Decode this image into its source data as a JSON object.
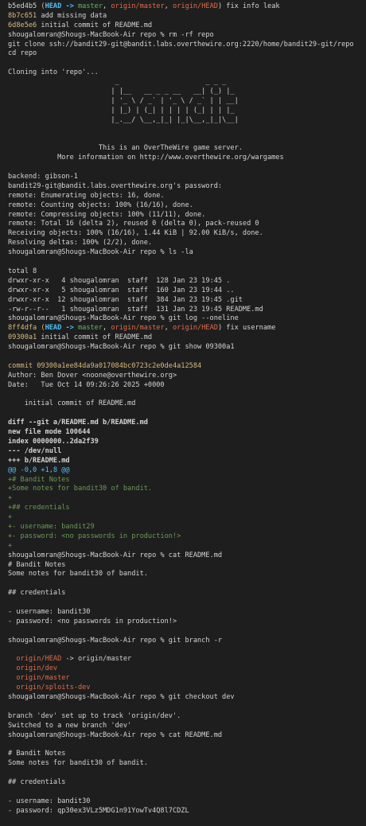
{
  "lines": [
    [
      [
        "b5ed4b5",
        ""
      ],
      [
        " (",
        "yellow"
      ],
      [
        "HEAD -> ",
        "cyan b"
      ],
      [
        "master",
        "grn"
      ],
      [
        ", ",
        ""
      ],
      [
        "origin/master",
        "red"
      ],
      [
        ", ",
        ""
      ],
      [
        "origin/HEAD",
        "red"
      ],
      [
        ") fix info leak",
        ""
      ]
    ],
    [
      [
        "8b7c651",
        "yellow"
      ],
      [
        " add missing data",
        ""
      ]
    ],
    [
      [
        "6d8e5e6",
        "yellow"
      ],
      [
        " initial commit of README.md",
        ""
      ]
    ],
    [
      [
        "shougalomran@Shougs-MacBook-Air repo % rm -rf repo",
        ""
      ]
    ],
    [
      [
        "git clone ssh://bandit29-git@bandit.labs.overthewire.org:2220/home/bandit29-git/repo",
        ""
      ]
    ],
    [
      [
        "cd repo",
        ""
      ]
    ],
    [
      [
        "",
        ""
      ]
    ],
    [
      [
        "Cloning into 'repo'...",
        ""
      ]
    ],
    [
      [
        "                          _                     _ _ _",
        ""
      ]
    ],
    [
      [
        "                         | |__   __ _ _ __   __| (_) |_",
        ""
      ]
    ],
    [
      [
        "                         | '_ \\ / _` | '_ \\ / _` | | __|",
        ""
      ]
    ],
    [
      [
        "                         | |_) | (_| | | | | (_| | | |_",
        ""
      ]
    ],
    [
      [
        "                         |_.__/ \\__,_|_| |_|\\__,_|_|\\__|",
        ""
      ]
    ],
    [
      [
        "",
        ""
      ]
    ],
    [
      [
        "",
        ""
      ]
    ],
    [
      [
        "                      This is an OverTheWire game server.",
        ""
      ]
    ],
    [
      [
        "            More information on http://www.overthewire.org/wargames",
        ""
      ]
    ],
    [
      [
        "",
        ""
      ]
    ],
    [
      [
        "backend: gibson-1",
        ""
      ]
    ],
    [
      [
        "bandit29-git@bandit.labs.overthewire.org's password:",
        ""
      ]
    ],
    [
      [
        "remote: Enumerating objects: 16, done.",
        ""
      ]
    ],
    [
      [
        "remote: Counting objects: 100% (16/16), done.",
        ""
      ]
    ],
    [
      [
        "remote: Compressing objects: 100% (11/11), done.",
        ""
      ]
    ],
    [
      [
        "remote: Total 16 (delta 2), reused 0 (delta 0), pack-reused 0",
        ""
      ]
    ],
    [
      [
        "Receiving objects: 100% (16/16), 1.44 KiB | 92.00 KiB/s, done.",
        ""
      ]
    ],
    [
      [
        "Resolving deltas: 100% (2/2), done.",
        ""
      ]
    ],
    [
      [
        "shougalomran@Shougs-MacBook-Air repo % ls -la",
        ""
      ]
    ],
    [
      [
        "",
        ""
      ]
    ],
    [
      [
        "total 8",
        ""
      ]
    ],
    [
      [
        "drwxr-xr-x   4 shougalomran  staff  128 Jan 23 19:45 .",
        ""
      ]
    ],
    [
      [
        "drwxr-xr-x   5 shougalomran  staff  160 Jan 23 19:44 ..",
        ""
      ]
    ],
    [
      [
        "drwxr-xr-x  12 shougalomran  staff  384 Jan 23 19:45 .git",
        ""
      ]
    ],
    [
      [
        "-rw-r--r--   1 shougalomran  staff  131 Jan 23 19:45 README.md",
        ""
      ]
    ],
    [
      [
        "shougalomran@Shougs-MacBook-Air repo % git log --oneline",
        ""
      ]
    ],
    [
      [
        "8ff4dfa",
        "yellow"
      ],
      [
        " (",
        "yellow"
      ],
      [
        "HEAD -> ",
        "cyan b"
      ],
      [
        "master",
        "grn"
      ],
      [
        ", ",
        ""
      ],
      [
        "origin/master",
        "red"
      ],
      [
        ", ",
        ""
      ],
      [
        "origin/HEAD",
        "red"
      ],
      [
        ") fix username",
        ""
      ]
    ],
    [
      [
        "09300a1",
        "yellow"
      ],
      [
        " initial commit of README.md",
        ""
      ]
    ],
    [
      [
        "shougalomran@Shougs-MacBook-Air repo % git show 09300a1",
        ""
      ]
    ],
    [
      [
        "",
        ""
      ]
    ],
    [
      [
        "commit 09300a1ee84da9a017084bc0723c2e0de4a12584",
        "yellow"
      ]
    ],
    [
      [
        "Author: Ben Dover <noone@overthewire.org>",
        ""
      ]
    ],
    [
      [
        "Date:   Tue Oct 14 09:26:26 2025 +0000",
        ""
      ]
    ],
    [
      [
        "",
        ""
      ]
    ],
    [
      [
        "    initial commit of README.md",
        ""
      ]
    ],
    [
      [
        "",
        ""
      ]
    ],
    [
      [
        "diff --git a/README.md b/README.md",
        "b"
      ]
    ],
    [
      [
        "new file mode 100644",
        "b"
      ]
    ],
    [
      [
        "index 0000000..2da2f39",
        "b"
      ]
    ],
    [
      [
        "--- /dev/null",
        "b"
      ]
    ],
    [
      [
        "+++ b/README.md",
        "b"
      ]
    ],
    [
      [
        "@@ -0,0 +1,8 @@",
        "cyan"
      ]
    ],
    [
      [
        "+# Bandit Notes",
        "green"
      ]
    ],
    [
      [
        "+Some notes for bandit30 of bandit.",
        "green"
      ]
    ],
    [
      [
        "+",
        "green"
      ]
    ],
    [
      [
        "+## credentials",
        "green"
      ]
    ],
    [
      [
        "+",
        "green"
      ]
    ],
    [
      [
        "+- username: bandit29",
        "green"
      ]
    ],
    [
      [
        "+- password: <no passwords in production!>",
        "green"
      ]
    ],
    [
      [
        "+",
        "green"
      ]
    ],
    [
      [
        "shougalomran@Shougs-MacBook-Air repo % cat README.md",
        ""
      ]
    ],
    [
      [
        "# Bandit Notes",
        ""
      ]
    ],
    [
      [
        "Some notes for bandit30 of bandit.",
        ""
      ]
    ],
    [
      [
        "",
        ""
      ]
    ],
    [
      [
        "## credentials",
        ""
      ]
    ],
    [
      [
        "",
        ""
      ]
    ],
    [
      [
        "- username: bandit30",
        ""
      ]
    ],
    [
      [
        "- password: <no passwords in production!>",
        ""
      ]
    ],
    [
      [
        "",
        ""
      ]
    ],
    [
      [
        "shougalomran@Shougs-MacBook-Air repo % git branch -r",
        ""
      ]
    ],
    [
      [
        "",
        ""
      ]
    ],
    [
      [
        "  origin/HEAD",
        "red"
      ],
      [
        " -> origin/master",
        ""
      ]
    ],
    [
      [
        "  origin/dev",
        "red"
      ]
    ],
    [
      [
        "  origin/master",
        "red"
      ]
    ],
    [
      [
        "  origin/sploits-dev",
        "red"
      ]
    ],
    [
      [
        "shougalomran@Shougs-MacBook-Air repo % git checkout dev",
        ""
      ]
    ],
    [
      [
        "",
        ""
      ]
    ],
    [
      [
        "branch 'dev' set up to track 'origin/dev'.",
        ""
      ]
    ],
    [
      [
        "Switched to a new branch 'dev'",
        ""
      ]
    ],
    [
      [
        "shougalomran@Shougs-MacBook-Air repo % cat README.md",
        ""
      ]
    ],
    [
      [
        "",
        ""
      ]
    ],
    [
      [
        "# Bandit Notes",
        ""
      ]
    ],
    [
      [
        "Some notes for bandit30 of bandit.",
        ""
      ]
    ],
    [
      [
        "",
        ""
      ]
    ],
    [
      [
        "## credentials",
        ""
      ]
    ],
    [
      [
        "",
        ""
      ]
    ],
    [
      [
        "- username: bandit30",
        ""
      ]
    ],
    [
      [
        "- password: qp30ex3VLz5MDG1n91YowTv4Q8l7CDZL",
        ""
      ]
    ]
  ]
}
